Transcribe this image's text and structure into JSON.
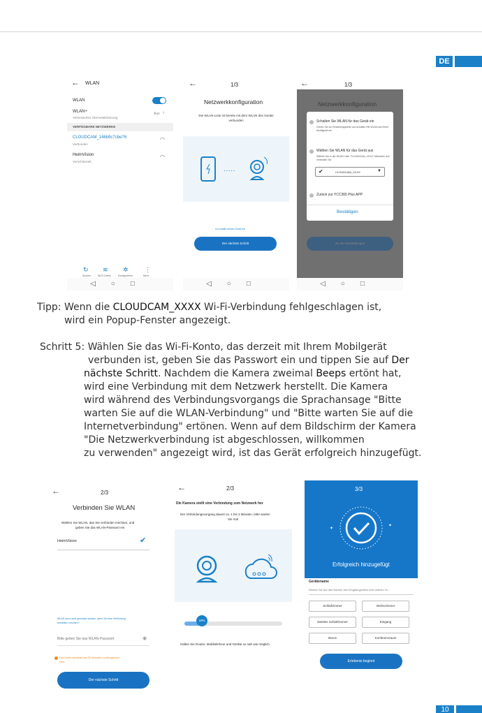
{
  "lang": "DE",
  "page_number": "10",
  "s1": {
    "title": "WLAN",
    "wlan_label": "WLAN",
    "wlanplus_label": "WLAN+",
    "wlanplus_desc": "Verbessertes Internetaktivierung",
    "wlanplus_value": "Aus",
    "section": "VERFÜGBARE NETZWERKE",
    "net1_name": "CLOUDCAM_146b9c7cbe76",
    "net1_status": "Verbunden",
    "net2_name": "HeimVision",
    "net2_status": "Verschlüsselt",
    "bottom": [
      "Suchen",
      "Wi-Fi-Direct",
      "Konfigurieren",
      "Mehr"
    ]
  },
  "s2": {
    "step": "1/3",
    "title": "Netzwerkkonfiguration",
    "desc": "Die WLAN-Liste ist bereits mit dem WLAN des Geräts verbunden",
    "link": "Ich erhalte keinen Gerät ein",
    "button": "Der nächste Schritt"
  },
  "s3": {
    "step": "1/3",
    "title": "Netzwerkkonfiguration",
    "opt1": "Schalten Sie WLAN für das Gerät ein",
    "opt1_desc": "Gehen Sie zur Einstellungsseite und schalten Sie WLAN auf Ihrem Mobilgerät ein",
    "opt2": "Wählen Sie WLAN für das Gerät aus",
    "opt2_desc": "Wählen Sie in der WLAN-Liste \"CLOUDCAM_XXXX\" Netzwerk und verbinden Sie",
    "select": "CLOUDCAM_XXXX",
    "opt3": "Zurück zur YCC365 Plus APP",
    "confirm": "Bestätigen",
    "button": "Zu den Einstellungen"
  },
  "tip": {
    "label": "Tipp:",
    "pre": "Wenn die",
    "bold": "CLOUDCAM_XXXX",
    "post": "Wi-Fi-Verbindung fehlgeschlagen ist,",
    "line2": "wird ein Popup-Fenster angezeigt."
  },
  "step5": {
    "label": "Schritt 5:",
    "l1": "Wählen Sie das Wi-Fi-Konto, das derzeit mit Ihrem Mobilgerät",
    "l2a": "verbunden ist, geben Sie das Passwort ein und tippen Sie auf",
    "l2b": "Der",
    "l3a": "nächste Schritt",
    "l3b": ". Nachdem die Kamera zweimal",
    "l3c": "Beeps",
    "l3d": "ertönt hat,",
    "l4": "wird eine Verbindung mit dem Netzwerk herstellt. Die Kamera",
    "l5": "wird während des Verbindungsvorgangs die Sprachansage \"Bitte",
    "l6": "warten Sie auf die WLAN-Verbindung\" und \"Bitte warten Sie auf die",
    "l7": "Internetverbindung\" ertönen. Wenn auf dem Bildschirm der Kamera",
    "l8": "\"Die Netzwerkverbindung ist abgeschlossen, willkommen",
    "l9": "zu verwenden\" angezeigt wird, ist das Gerät erfolgreich hinzugefügt."
  },
  "s4": {
    "step": "2/3",
    "title": "Verbinden Sie WLAN",
    "desc1": "Wählen Sie WLAN, das Sie verbinden möchten, und",
    "desc2": "geben Sie das WLAN-Passwort ein",
    "network": "HeimVision",
    "warn1": "WLAN kann nicht gefunden werden, wenn Sie eine Verbindung",
    "warn2": "herstellen möchten?",
    "password_placeholder": "Bitte geben Sie das WLAN-Passwort",
    "note1": "Das Gerät unterstützt das 5G-Netzwerk vorübergehend",
    "note2": "nicht",
    "button": "Der nächste Schritt"
  },
  "s5": {
    "step": "2/3",
    "title": "Die Kamera stellt eine Verbindung zum Netzwerk her",
    "desc1": "Der Verbindungsvorgang dauert ca. 1 bis 2 Minuten, bitte warten",
    "desc2": "Sie mal",
    "progress_label": "18%",
    "progress": 0.18,
    "hint": "Halten Sie Router, Mobiltelefone und Geräte so nah wie möglich"
  },
  "s6": {
    "step": "3/3",
    "success": "Erfolgreich hinzugefügt",
    "name_label": "Gerätename",
    "name_placeholder": "Klicken Sie auf den Namen des Eingabegerätes oder wählen Si...",
    "rooms": [
      "Schlafzimmer",
      "Wohnzimmer",
      "Zweites Schlafzimmer",
      "Eingang",
      "Büros",
      "Konferenzraum"
    ],
    "button": "Erlebenis beginnt"
  },
  "colors": {
    "accent": "#1a80c8",
    "success_bg": "#1677c9",
    "overlay": "#707070"
  }
}
